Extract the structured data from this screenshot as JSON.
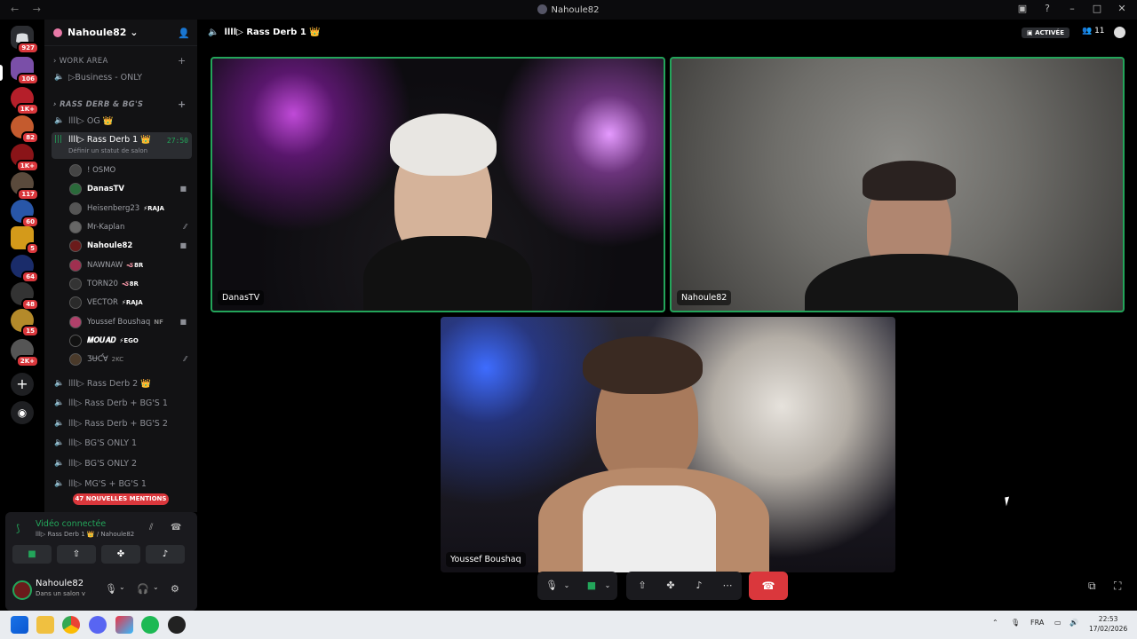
{
  "window": {
    "title": "Nahoule82"
  },
  "guilds": {
    "badges": [
      "927",
      "106",
      "1K+",
      "82",
      "1K+",
      "117",
      "60",
      "5",
      "64",
      "48",
      "15",
      "2K+"
    ]
  },
  "server": {
    "name": "Nahoule82"
  },
  "categories": {
    "work": "WORK AREA",
    "rass": "RASS DERB & BG'S"
  },
  "channels": {
    "business": "Business - ONLY",
    "og": "llll▷ OG 👑",
    "rass1": "llll▷ Rass Derb 1 👑",
    "rass1_timer": "27:50",
    "rass1_status": "Définir un statut de salon",
    "rass2": "llll▷ Rass Derb 2 👑",
    "rbg1": "lll▷ Rass Derb + BG'S 1",
    "rbg2": "lll▷ Rass Derb + BG'S 2",
    "bg1": "lll▷ BG'S ONLY 1",
    "bg2": "lll▷ BG'S ONLY 2",
    "mg1": "lll▷ MG'S + BG'S 1"
  },
  "voice_users": [
    {
      "name": "! OSMO",
      "tag": ""
    },
    {
      "name": "DanasTV",
      "tag": ""
    },
    {
      "name": "Heisenberg23",
      "tag": "⚡RAJA"
    },
    {
      "name": "Mr-Kaplan",
      "tag": ""
    },
    {
      "name": "Nahoule82",
      "tag": ""
    },
    {
      "name": "NAWNAW",
      "tag": "🪱8R"
    },
    {
      "name": "TORN20",
      "tag": "🪱8R"
    },
    {
      "name": "VECTOR",
      "tag": "⚡RAJA"
    },
    {
      "name": "Youssef Boushaq",
      "tag": "NF"
    },
    {
      "name": "𝑴𝑶𝑼𝑨𝑫",
      "tag": "⚡EGO"
    },
    {
      "name": "ƷɄƇⱯ",
      "tag": "2KC"
    }
  ],
  "mentions": "47 NOUVELLES MENTIONS",
  "voicebar": {
    "title": "Vidéo connectée",
    "sub": "lll▷ Rass Derb 1 👑 / Nahoule82"
  },
  "userbar": {
    "name": "Nahoule82",
    "status": "Dans un salon v"
  },
  "call": {
    "channel": "llll▷ Rass Derb 1 👑",
    "active_label": "ACTIVÉE",
    "people_count": "11"
  },
  "tiles": {
    "t1": "DanasTV",
    "t2": "Nahoule82",
    "t3": "Youssef Boushaq"
  },
  "taskbar": {
    "lang": "FRA",
    "time": "22:53",
    "date": "17/02/2026"
  }
}
